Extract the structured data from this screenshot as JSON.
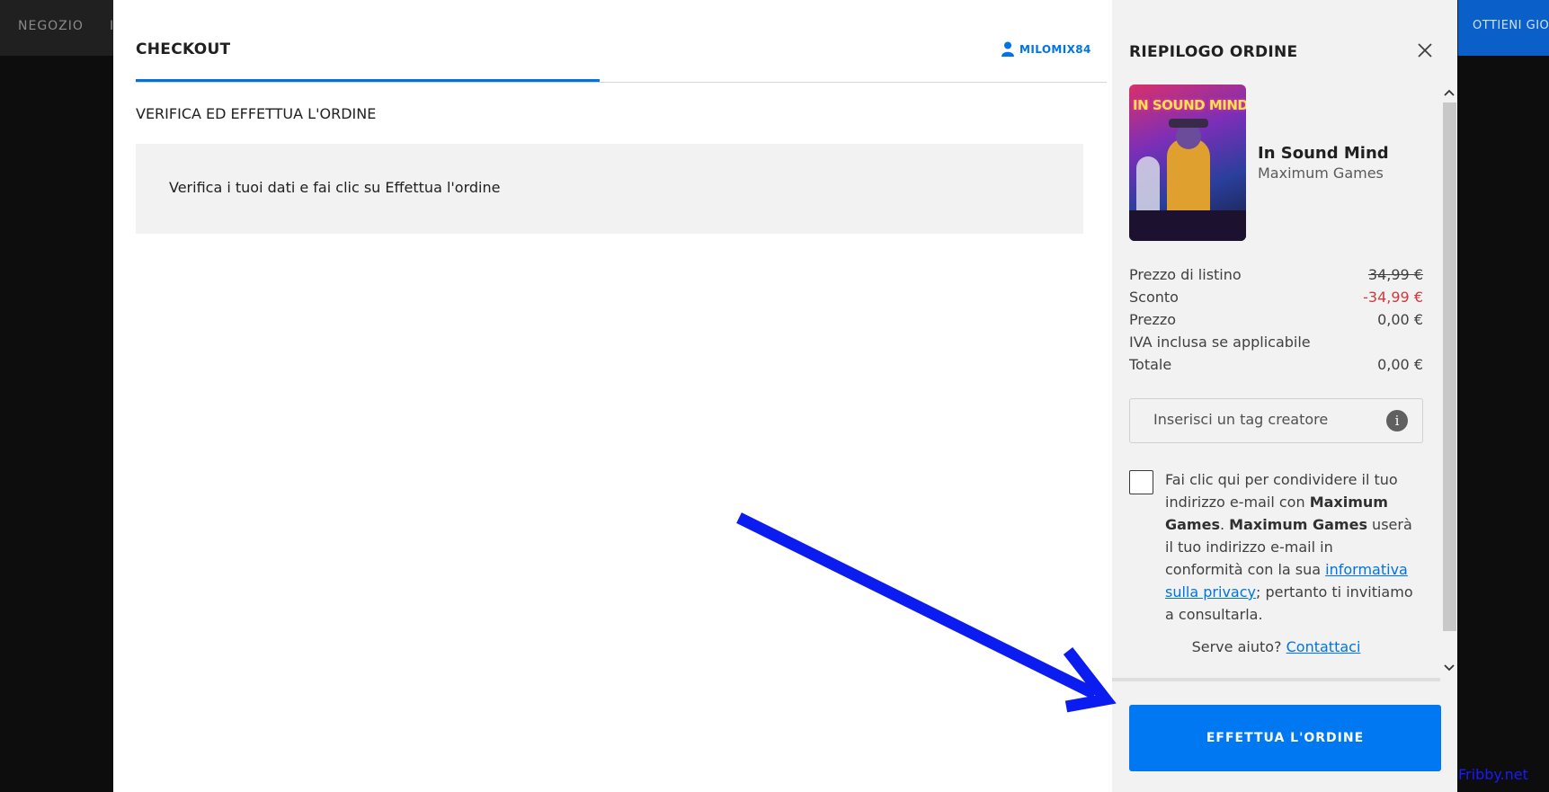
{
  "store": {
    "nav_left": "NEGOZIO",
    "nav_left_partial": "I",
    "cta_partial": "OTTIENI GIOC"
  },
  "checkout": {
    "title": "CHECKOUT",
    "username": "MILOMIX84",
    "section_title": "VERIFICA ED EFFETTUA L'ORDINE",
    "info_text": "Verifica i tuoi dati e fai clic su Effettua l'ordine"
  },
  "summary": {
    "title": "RIEPILOGO ORDINE",
    "game": {
      "name": "In Sound Mind",
      "publisher": "Maximum Games",
      "cover_logo": "IN SOUND MIND"
    },
    "prices": [
      {
        "label": "Prezzo di listino",
        "value": "34,99 €",
        "style": "strike"
      },
      {
        "label": "Sconto",
        "value": "-34,99 €",
        "style": "discount"
      },
      {
        "label": "Prezzo",
        "value": "0,00 €",
        "style": "normal"
      },
      {
        "label": "IVA inclusa se applicabile",
        "value": "",
        "style": "normal"
      },
      {
        "label": "Totale",
        "value": "0,00 €",
        "style": "normal"
      }
    ],
    "creator_tag_placeholder": "Inserisci un tag creatore",
    "info_icon_glyph": "i",
    "consent": {
      "part1": "Fai clic qui per condividere il tuo indirizzo e-mail con ",
      "publisher_bold_1": "Maximum Games",
      "part2": ". ",
      "publisher_bold_2": "Maximum Games",
      "part3": " userà il tuo indirizzo e-mail in conformità con la sua ",
      "privacy_link": "informativa sulla privacy",
      "part4": "; pertanto ti invitiamo a consultarla."
    },
    "help_text": "Serve aiuto?",
    "help_link": "Contattaci",
    "place_order_label": "EFFETTUA L'ORDINE"
  },
  "colors": {
    "accent_blue": "#0074e4",
    "place_order_blue": "#0078f2",
    "discount_red": "#d0393e",
    "annotation_arrow": "#0a1cf0"
  },
  "icons": [
    "user-icon",
    "close-icon",
    "info-icon",
    "chevron-up-icon",
    "chevron-down-icon"
  ],
  "watermark": "Fribby.net"
}
